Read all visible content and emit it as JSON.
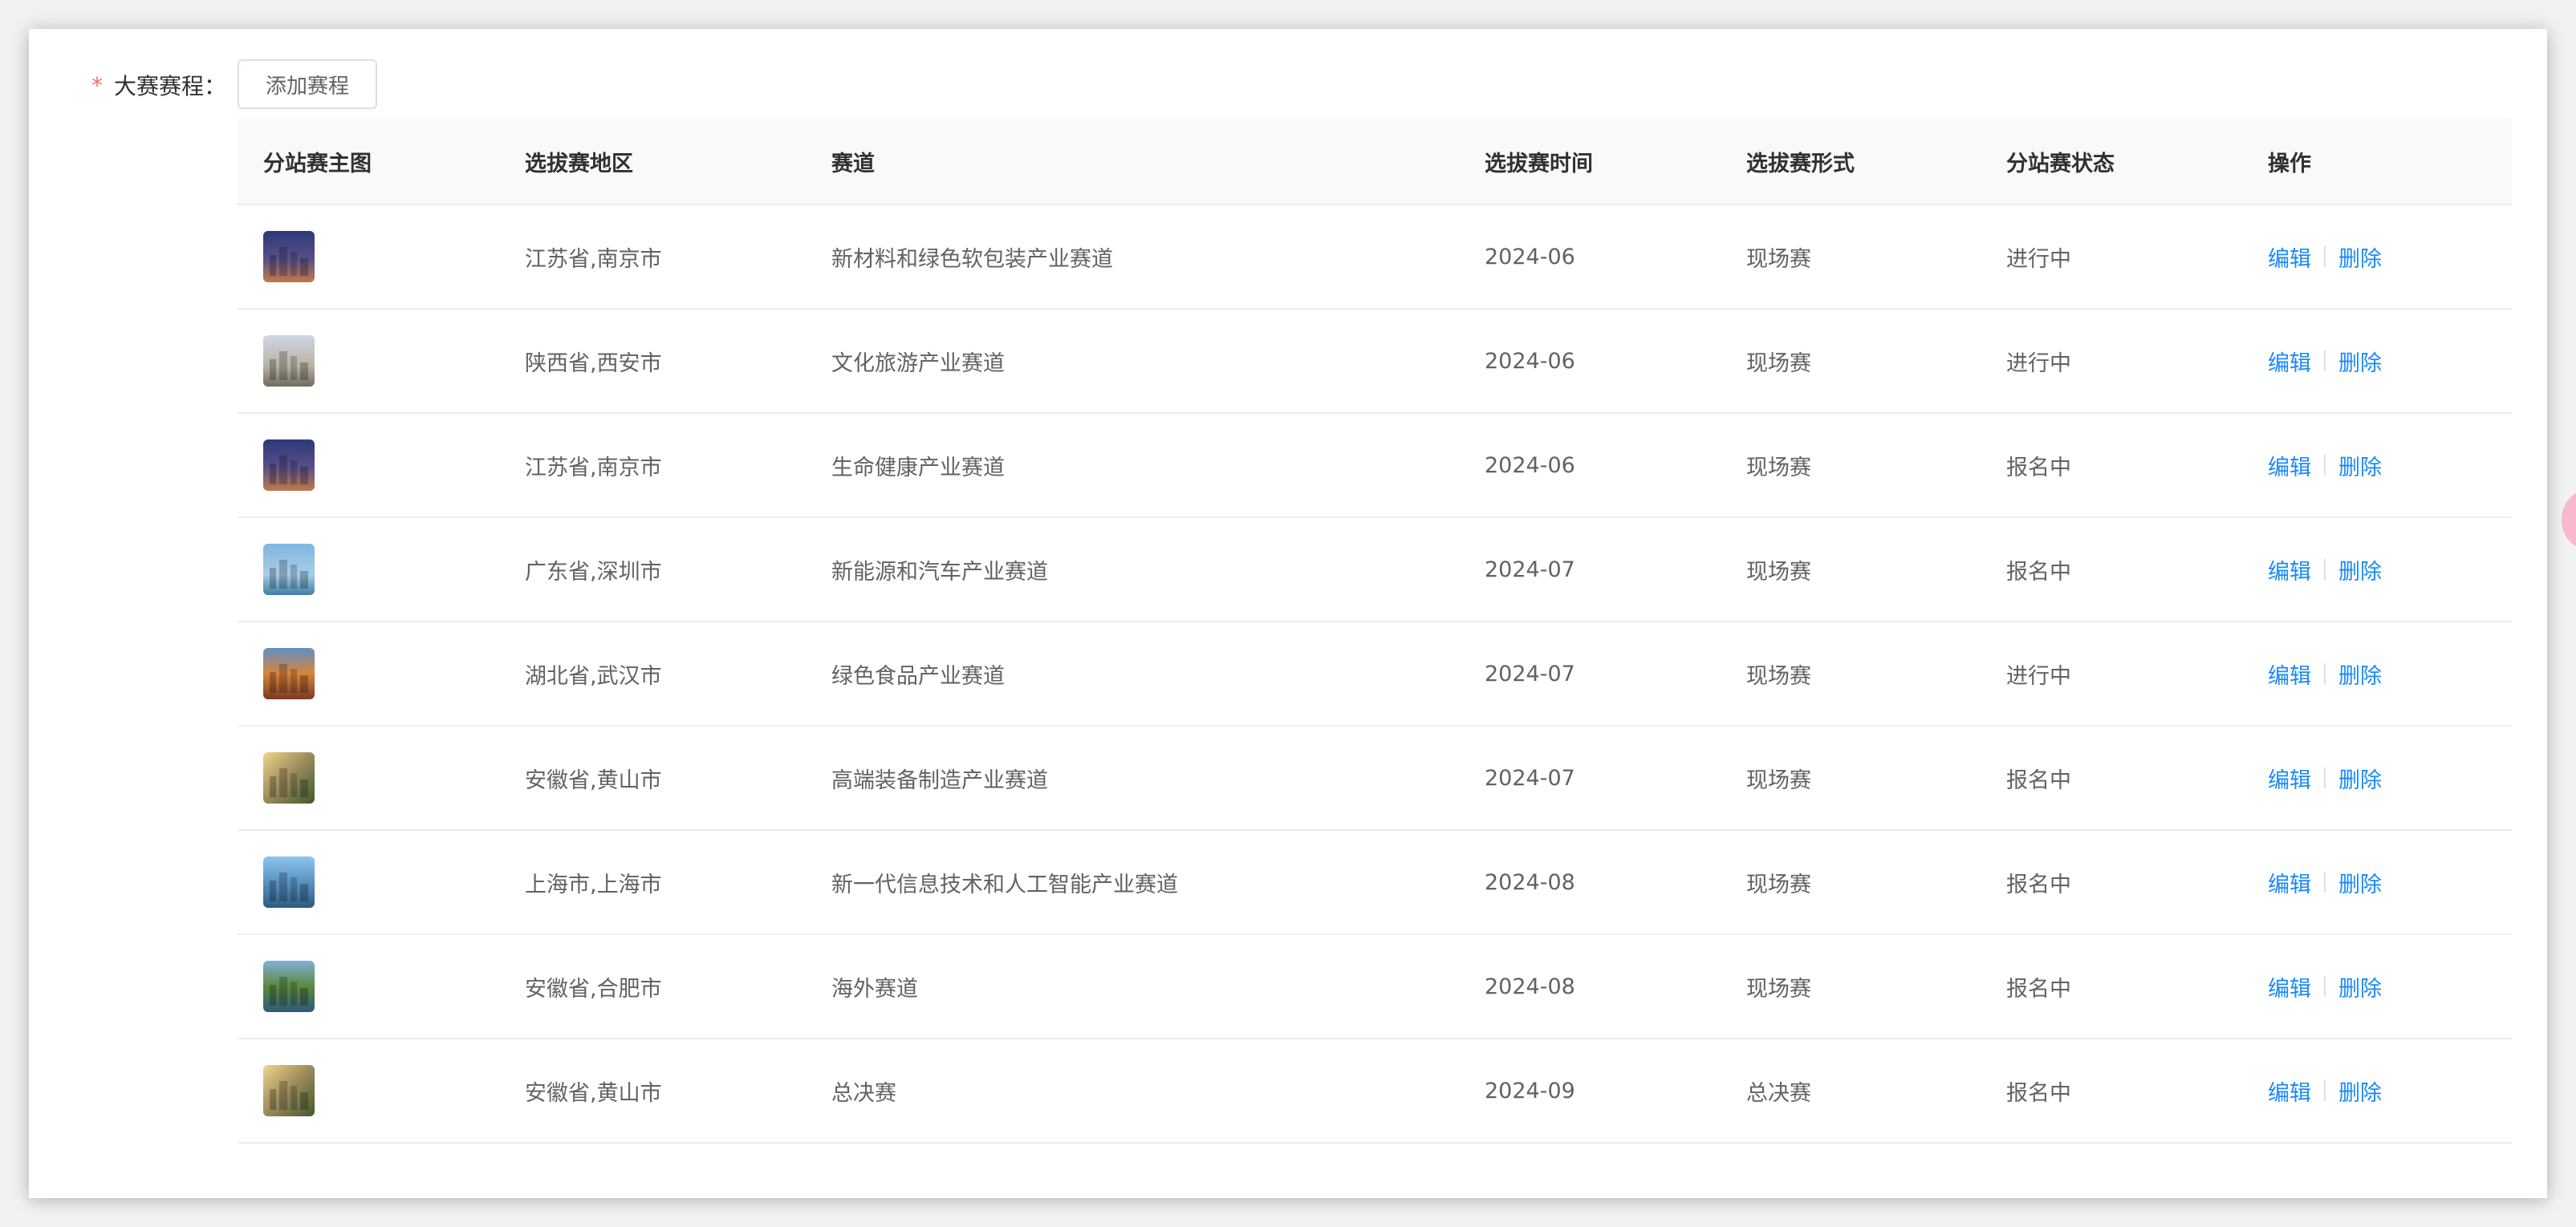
{
  "form": {
    "required_mark": "*",
    "label": "大赛赛程：",
    "add_button": "添加赛程"
  },
  "table": {
    "headers": [
      "分站赛主图",
      "选拔赛地区",
      "赛道",
      "选拔赛时间",
      "选拔赛形式",
      "分站赛状态",
      "操作"
    ],
    "action_edit": "编辑",
    "action_delete": "删除",
    "rows": [
      {
        "thumb": "nanjing-night",
        "region": "江苏省,南京市",
        "track": "新材料和绿色软包装产业赛道",
        "time": "2024-06",
        "format": "现场赛",
        "status": "进行中"
      },
      {
        "thumb": "xian-bell-tower",
        "region": "陕西省,西安市",
        "track": "文化旅游产业赛道",
        "time": "2024-06",
        "format": "现场赛",
        "status": "进行中"
      },
      {
        "thumb": "nanjing-night",
        "region": "江苏省,南京市",
        "track": "生命健康产业赛道",
        "time": "2024-06",
        "format": "现场赛",
        "status": "报名中"
      },
      {
        "thumb": "shenzhen-skyline",
        "region": "广东省,深圳市",
        "track": "新能源和汽车产业赛道",
        "time": "2024-07",
        "format": "现场赛",
        "status": "报名中"
      },
      {
        "thumb": "wuhan-tower",
        "region": "湖北省,武汉市",
        "track": "绿色食品产业赛道",
        "time": "2024-07",
        "format": "现场赛",
        "status": "进行中"
      },
      {
        "thumb": "huangshan-mountain",
        "region": "安徽省,黄山市",
        "track": "高端装备制造产业赛道",
        "time": "2024-07",
        "format": "现场赛",
        "status": "报名中"
      },
      {
        "thumb": "shanghai-skyline",
        "region": "上海市,上海市",
        "track": "新一代信息技术和人工智能产业赛道",
        "time": "2024-08",
        "format": "现场赛",
        "status": "报名中"
      },
      {
        "thumb": "hefei-lake",
        "region": "安徽省,合肥市",
        "track": "海外赛道",
        "time": "2024-08",
        "format": "现场赛",
        "status": "报名中"
      },
      {
        "thumb": "huangshan-mountain",
        "region": "安徽省,黄山市",
        "track": "总决赛",
        "time": "2024-09",
        "format": "总决赛",
        "status": "报名中"
      }
    ]
  },
  "colors": {
    "link": "#1989fa",
    "required": "#f56c6c",
    "header_bg": "#f9f9f9",
    "border": "#ebeef5"
  }
}
